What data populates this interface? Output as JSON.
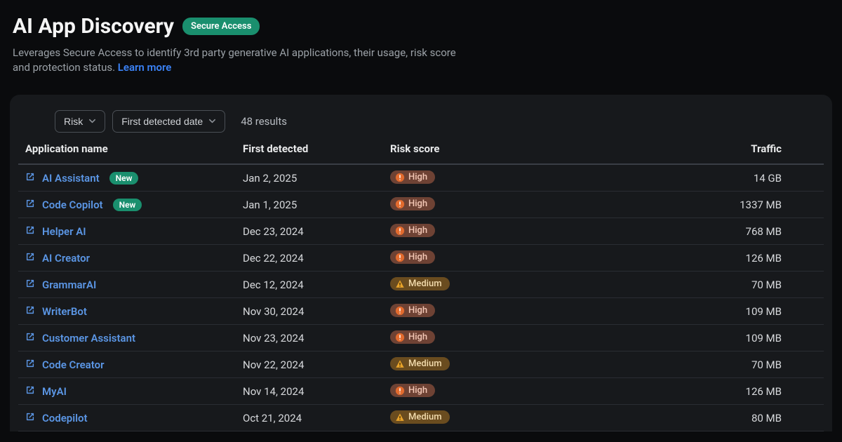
{
  "header": {
    "title": "AI App Discovery",
    "secure_badge": "Secure Access",
    "subtitle_before": "Leverages Secure Access to identify 3rd party generative AI applications, their usage, risk score and protection status. ",
    "learn_more": "Learn more"
  },
  "controls": {
    "risk_label": "Risk",
    "detected_label": "First detected date",
    "results": "48 results"
  },
  "table": {
    "headers": {
      "app": "Application name",
      "detected": "First detected",
      "risk": "Risk score",
      "traffic": "Traffic"
    },
    "new_label": "New",
    "risk_labels": {
      "high": "High",
      "medium": "Medium"
    },
    "rows": [
      {
        "name": "AI Assistant",
        "new": true,
        "detected": "Jan 2, 2025",
        "risk": "high",
        "traffic": "14 GB"
      },
      {
        "name": "Code Copilot",
        "new": true,
        "detected": "Jan 1, 2025",
        "risk": "high",
        "traffic": "1337 MB"
      },
      {
        "name": "Helper AI",
        "new": false,
        "detected": "Dec 23, 2024",
        "risk": "high",
        "traffic": "768 MB"
      },
      {
        "name": "AI Creator",
        "new": false,
        "detected": "Dec 22, 2024",
        "risk": "high",
        "traffic": "126 MB"
      },
      {
        "name": "GrammarAI",
        "new": false,
        "detected": "Dec 12, 2024",
        "risk": "medium",
        "traffic": "70 MB"
      },
      {
        "name": "WriterBot",
        "new": false,
        "detected": "Nov 30, 2024",
        "risk": "high",
        "traffic": "109 MB"
      },
      {
        "name": "Customer Assistant",
        "new": false,
        "detected": "Nov 23, 2024",
        "risk": "high",
        "traffic": "109 MB"
      },
      {
        "name": "Code Creator",
        "new": false,
        "detected": "Nov 22, 2024",
        "risk": "medium",
        "traffic": "70 MB"
      },
      {
        "name": "MyAI",
        "new": false,
        "detected": "Nov 14, 2024",
        "risk": "high",
        "traffic": "126 MB"
      },
      {
        "name": "Codepilot",
        "new": false,
        "detected": "Oct 21, 2024",
        "risk": "medium",
        "traffic": "80 MB"
      }
    ]
  }
}
